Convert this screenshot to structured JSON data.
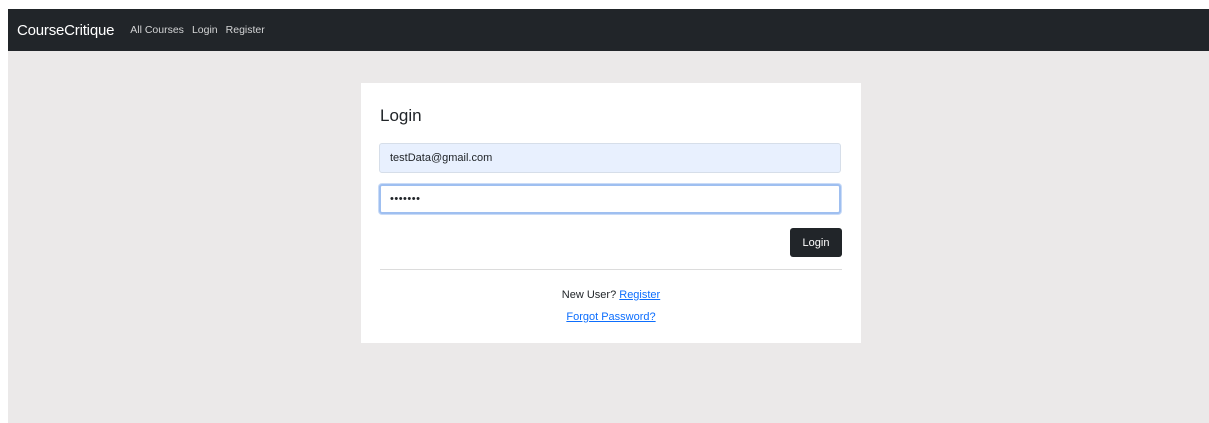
{
  "navbar": {
    "brand": "CourseCritique",
    "links": [
      "All Courses",
      "Login",
      "Register"
    ]
  },
  "login_form": {
    "title": "Login",
    "email_value": "testData@gmail.com",
    "password_value": "•••••••",
    "submit_label": "Login",
    "new_user_text": "New User?",
    "register_link": "Register",
    "forgot_password_link": "Forgot Password?"
  },
  "colors": {
    "navbar_bg": "#212529",
    "page_bg": "#ebe9e9",
    "autofill_bg": "#e8f0fe",
    "focus_border": "#9fbff0",
    "link": "#0d6efd",
    "button_bg": "#212529"
  }
}
